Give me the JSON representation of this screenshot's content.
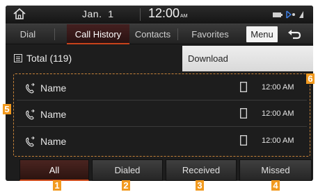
{
  "status": {
    "date": "Jan.  1",
    "time": "12:00",
    "ampm": "AM"
  },
  "tabs": [
    {
      "label": "Dial"
    },
    {
      "label": "Call History"
    },
    {
      "label": "Contacts"
    },
    {
      "label": "Favorites"
    }
  ],
  "menu_label": "Menu",
  "total_label": "Total (119)",
  "dropdown": {
    "item": "Download"
  },
  "calls": [
    {
      "name": "Name",
      "time": "12:00 AM"
    },
    {
      "name": "Name",
      "time": "12:00 AM"
    },
    {
      "name": "Name",
      "time": "12:00 AM"
    }
  ],
  "filters": [
    {
      "label": "All"
    },
    {
      "label": "Dialed"
    },
    {
      "label": "Received"
    },
    {
      "label": "Missed"
    }
  ],
  "callouts": [
    "1",
    "2",
    "3",
    "4",
    "5",
    "6"
  ],
  "colors": {
    "accent": "#d04a1a",
    "callout": "#f29a1f"
  }
}
